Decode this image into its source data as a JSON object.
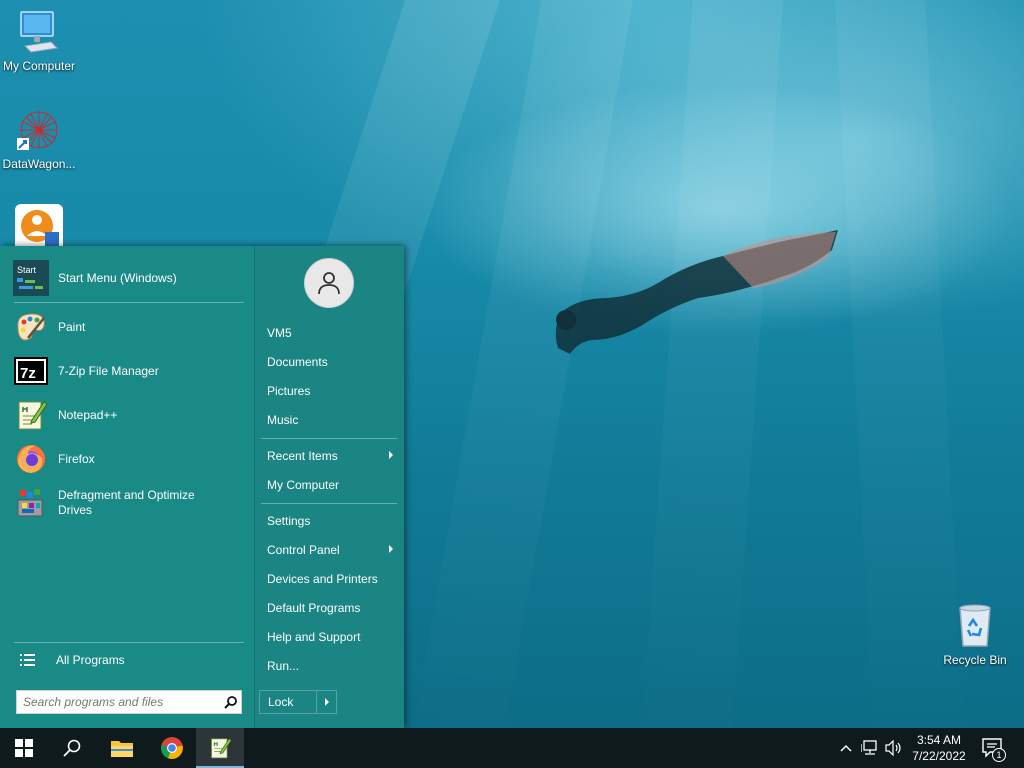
{
  "desktop": {
    "icons": [
      {
        "label": "My Computer",
        "icon": "monitor-icon"
      },
      {
        "label": "DataWagon...",
        "icon": "datawagon-icon"
      },
      {
        "label": "",
        "icon": "installer-icon"
      },
      {
        "label": "Recycle Bin",
        "icon": "recycle-bin-icon"
      }
    ]
  },
  "start_menu": {
    "pinned": {
      "label": "Start Menu (Windows)",
      "icon": "start-menu-app-icon"
    },
    "recent_programs": [
      {
        "label": "Paint",
        "icon": "paint-icon"
      },
      {
        "label": "7-Zip File Manager",
        "icon": "7zip-icon"
      },
      {
        "label": "Notepad++",
        "icon": "notepadpp-icon"
      },
      {
        "label": "Firefox",
        "icon": "firefox-icon"
      },
      {
        "label": "Defragment and Optimize Drives",
        "icon": "defrag-icon"
      }
    ],
    "all_programs": "All Programs",
    "search": {
      "placeholder": "Search programs and files"
    },
    "right": {
      "user": "VM5",
      "documents": "Documents",
      "pictures": "Pictures",
      "music": "Music",
      "recent_items": "Recent Items",
      "my_computer": "My Computer",
      "settings": "Settings",
      "control_panel": "Control Panel",
      "devices_printers": "Devices and Printers",
      "default_programs": "Default Programs",
      "help_support": "Help and Support",
      "run": "Run...",
      "lock": "Lock"
    }
  },
  "taskbar": {
    "apps": [
      "windows-start-icon",
      "search-icon",
      "file-explorer-icon",
      "chrome-icon",
      "notepadpp-icon"
    ],
    "clock": {
      "time": "3:54 AM",
      "date": "7/22/2022"
    },
    "notification_count": "1",
    "accent": "#1a8a86"
  }
}
